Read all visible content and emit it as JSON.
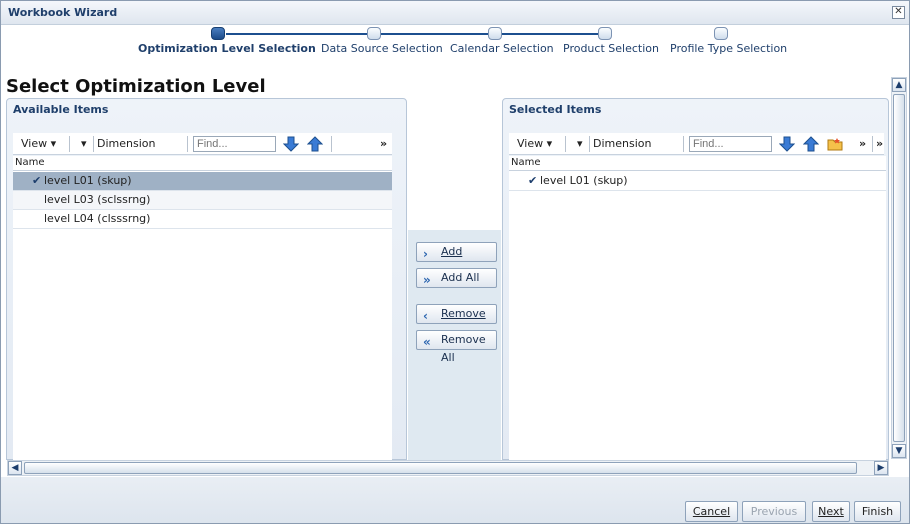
{
  "window": {
    "title": "Workbook Wizard"
  },
  "train": {
    "steps": [
      {
        "label": "Optimization Level Selection",
        "active": true
      },
      {
        "label": "Data Source Selection",
        "active": false
      },
      {
        "label": "Calendar Selection",
        "active": false
      },
      {
        "label": "Product Selection",
        "active": false
      },
      {
        "label": "Profile Type Selection",
        "active": false
      }
    ]
  },
  "heading": "Select Optimization Level",
  "available": {
    "title": "Available Items",
    "toolbar": {
      "view": "View",
      "dimension": "Dimension",
      "find_placeholder": "Find...",
      "more": "»"
    },
    "column": "Name",
    "rows": [
      {
        "label": "level L01 (skup)",
        "selected": true,
        "checked": true
      },
      {
        "label": "level L03 (sclssrng)",
        "selected": false,
        "checked": false
      },
      {
        "label": "level L04 (clsssrng)",
        "selected": false,
        "checked": false
      }
    ]
  },
  "selected": {
    "title": "Selected Items",
    "toolbar": {
      "view": "View",
      "dimension": "Dimension",
      "find_placeholder": "Find...",
      "more": "»"
    },
    "column": "Name",
    "rows": [
      {
        "label": "level L01 (skup)",
        "checked": true
      }
    ]
  },
  "shuttle": {
    "add": "Add",
    "add_all": "Add All",
    "remove": "Remove",
    "remove_all": "Remove All"
  },
  "footer": {
    "cancel": "Cancel",
    "previous": "Previous",
    "next": "Next",
    "finish": "Finish"
  },
  "colors": {
    "accent": "#1c4f8f",
    "selected_row": "#9fb1c5"
  }
}
